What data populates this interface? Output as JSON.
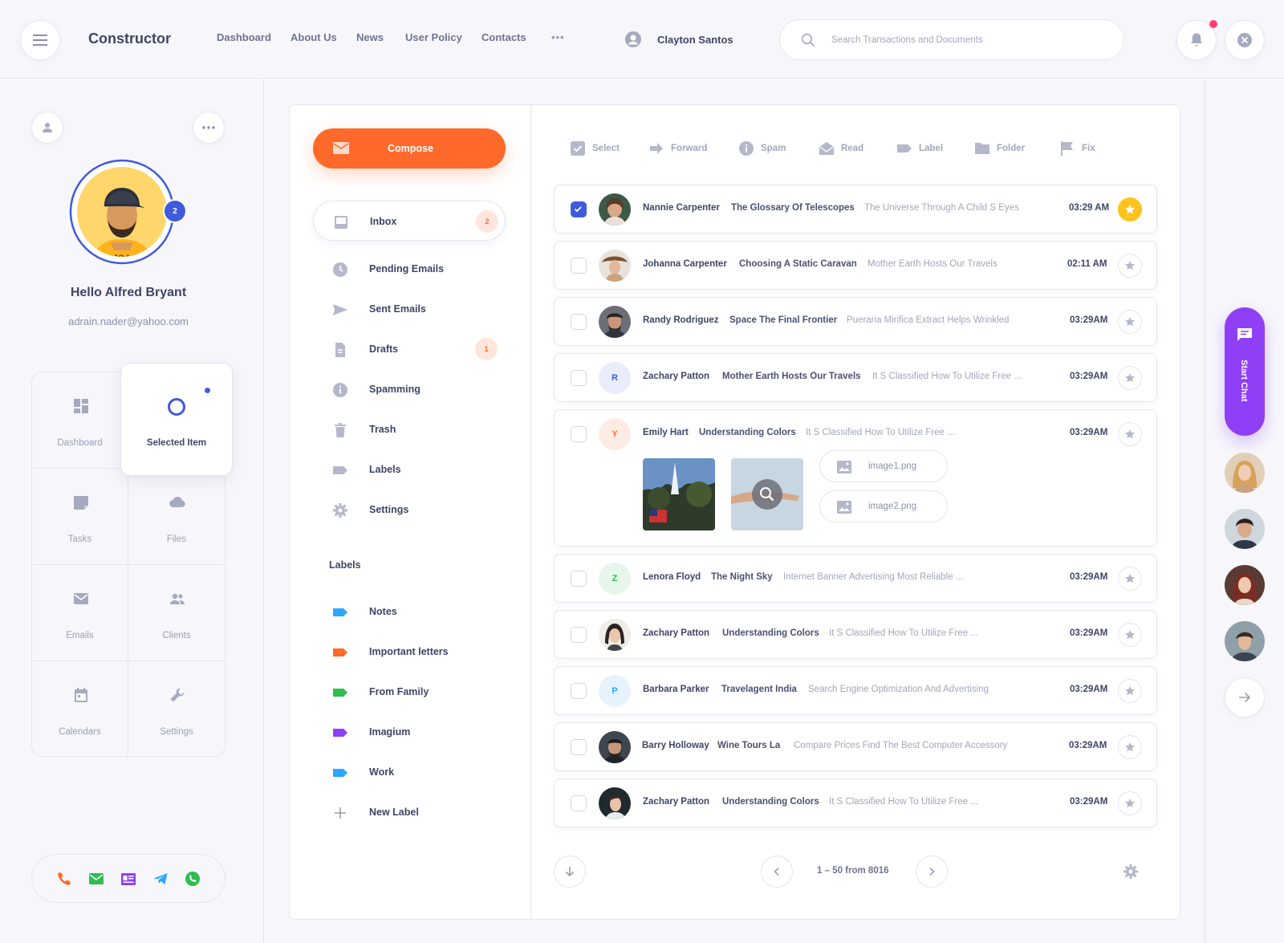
{
  "header": {
    "brand": "Constructor",
    "nav": [
      "Dashboard",
      "About Us",
      "News",
      "User Policy",
      "Contacts"
    ],
    "more": "•••",
    "user_name": "Clayton Santos",
    "search_placeholder": "Search Transactions and Documents"
  },
  "profile": {
    "greeting": "Hello Alfred Bryant",
    "email": "adrain.nader@yahoo.com",
    "notifications": "2"
  },
  "sidebar_grid": {
    "items": [
      "Dashboard",
      "Selected Item",
      "Tasks",
      "Files",
      "Emails",
      "Clients",
      "Calendars",
      "Settings"
    ]
  },
  "mailbox": {
    "compose": "Compose",
    "folders": [
      {
        "label": "Inbox",
        "badge": "2"
      },
      {
        "label": "Pending Emails"
      },
      {
        "label": "Sent Emails"
      },
      {
        "label": "Drafts",
        "badge": "1"
      },
      {
        "label": "Spamming"
      },
      {
        "label": "Trash"
      },
      {
        "label": "Labels"
      },
      {
        "label": "Settings"
      }
    ],
    "labels_heading": "Labels",
    "labels": [
      {
        "label": "Notes",
        "color": "#2aa7ff"
      },
      {
        "label": "Important letters",
        "color": "#ff6a2b"
      },
      {
        "label": "From Family",
        "color": "#2ebd4e"
      },
      {
        "label": "Imagium",
        "color": "#8f3ff5"
      },
      {
        "label": "Work",
        "color": "#2aa7ff"
      }
    ],
    "new_label": "New Label"
  },
  "toolbar": [
    "Select",
    "Forward",
    "Spam",
    "Read",
    "Label",
    "Folder",
    "Fix"
  ],
  "emails": [
    {
      "name": "Nannie Carpenter",
      "subject": "The Glossary Of Telescopes",
      "preview": "The Universe Through A Child S Eyes",
      "time": "03:29 AM",
      "checked": true,
      "starred": true
    },
    {
      "name": "Johanna Carpenter",
      "subject": "Choosing A Static Caravan",
      "preview": "Mother Earth Hosts Our Travels",
      "time": "02:11 AM"
    },
    {
      "name": "Randy Rodriguez",
      "subject": "Space The Final Frontier",
      "preview": "Pueraria Mirifica Extract Helps Wrinkled",
      "time": "03:29AM"
    },
    {
      "name": "Zachary Patton",
      "subject": "Mother Earth Hosts Our Travels",
      "preview": "It S Classified How To Utilize Free ...",
      "time": "03:29AM",
      "initial": "R"
    },
    {
      "name": "Emily Hart",
      "subject": "Understanding Colors",
      "preview": "It S Classified How To Utilize Free ...",
      "time": "03:29AM",
      "initial": "Y",
      "attachments": [
        "image1.png",
        "image2.png"
      ]
    },
    {
      "name": "Lenora Floyd",
      "subject": "The Night Sky",
      "preview": "Internet Banner Advertising Most Reliable ...",
      "time": "03:29AM",
      "initial": "Z"
    },
    {
      "name": "Zachary Patton",
      "subject": "Understanding Colors",
      "preview": "It S Classified How To Utilize Free ...",
      "time": "03:29AM"
    },
    {
      "name": "Barbara Parker",
      "subject": "Travelagent India",
      "preview": "Search Engine Optimization And Advertising",
      "time": "03:29AM",
      "initial": "P"
    },
    {
      "name": "Barry Holloway",
      "subject": "Wine Tours La",
      "preview": "Compare Prices Find The Best Computer Accessory",
      "time": "03:29AM"
    },
    {
      "name": "Zachary Patton",
      "subject": "Understanding Colors",
      "preview": "It S Classified How To Utilize Free ...",
      "time": "03:29AM"
    }
  ],
  "pagination": "1 – 50 from 8016",
  "chat": {
    "label": "Start Chat"
  },
  "colors": {
    "accent": "#ff6a2b",
    "primary": "#3f5bdb",
    "chat": "#8f3ff5",
    "star": "#ffc21f"
  }
}
